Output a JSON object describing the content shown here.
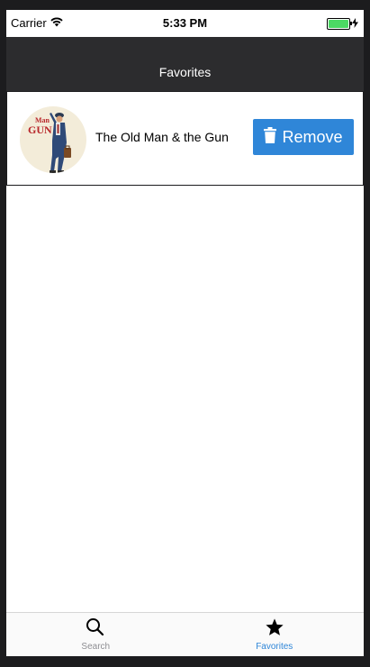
{
  "status_bar": {
    "carrier": "Carrier",
    "time": "5:33 PM"
  },
  "nav": {
    "title": "Favorites"
  },
  "favorites": [
    {
      "title": "The Old Man & the Gun",
      "poster_text_top": "Man",
      "poster_text_bottom": "GUN",
      "remove_label": "Remove"
    }
  ],
  "tabs": [
    {
      "label": "Search",
      "icon": "search-icon",
      "active": false
    },
    {
      "label": "Favorites",
      "icon": "star-icon",
      "active": true
    }
  ],
  "colors": {
    "nav_bg": "#2c2c2e",
    "accent": "#2f86d8",
    "tab_active": "#2f86d8",
    "tab_inactive": "#8e8e93",
    "battery": "#4cd964"
  }
}
